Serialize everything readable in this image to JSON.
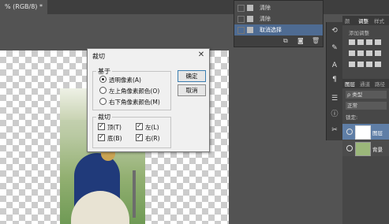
{
  "document": {
    "tab_label": "% (RGB/8) *"
  },
  "history": {
    "items": [
      {
        "label": "清除",
        "selected": false
      },
      {
        "label": "清除",
        "selected": false
      },
      {
        "label": "取消选择",
        "selected": true
      }
    ],
    "footer_icons": [
      "snapshot-icon",
      "camera-icon",
      "trash-icon"
    ]
  },
  "right_panel": {
    "top_tabs": [
      "颜",
      "调整",
      "样式"
    ],
    "adjust_title": "添加调整",
    "layer_tabs": [
      "图层",
      "通道",
      "路径"
    ],
    "kind_label": "ρ 类型",
    "blend_mode": "正常",
    "lock_label": "锁定:",
    "layers": [
      {
        "name": "图层",
        "selected": true
      },
      {
        "name": "背景",
        "selected": false
      }
    ]
  },
  "dialog": {
    "title": "裁切",
    "based_on_label": "基于",
    "options": [
      {
        "label": "透明像素(A)",
        "checked": true
      },
      {
        "label": "左上角像素颜色(O)",
        "checked": false
      },
      {
        "label": "右下角像素颜色(M)",
        "checked": false
      }
    ],
    "trim_label": "裁切",
    "trim_items": {
      "top": {
        "label": "顶(T)",
        "checked": true
      },
      "left": {
        "label": "左(L)",
        "checked": true
      },
      "bottom": {
        "label": "底(B)",
        "checked": true
      },
      "right": {
        "label": "右(R)",
        "checked": true
      }
    },
    "ok_label": "确定",
    "cancel_label": "取消"
  }
}
